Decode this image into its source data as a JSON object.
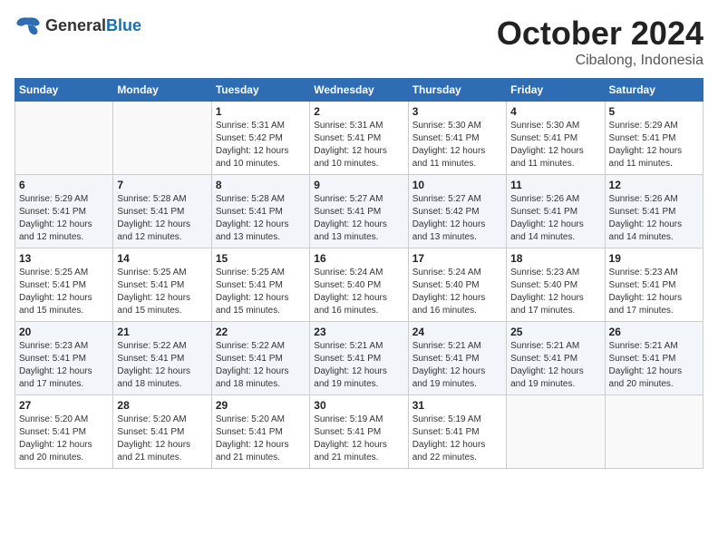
{
  "header": {
    "logo_general": "General",
    "logo_blue": "Blue",
    "month": "October 2024",
    "location": "Cibalong, Indonesia"
  },
  "days_of_week": [
    "Sunday",
    "Monday",
    "Tuesday",
    "Wednesday",
    "Thursday",
    "Friday",
    "Saturday"
  ],
  "weeks": [
    {
      "days": [
        {
          "num": "",
          "info": ""
        },
        {
          "num": "",
          "info": ""
        },
        {
          "num": "1",
          "info": "Sunrise: 5:31 AM\nSunset: 5:42 PM\nDaylight: 12 hours\nand 10 minutes."
        },
        {
          "num": "2",
          "info": "Sunrise: 5:31 AM\nSunset: 5:41 PM\nDaylight: 12 hours\nand 10 minutes."
        },
        {
          "num": "3",
          "info": "Sunrise: 5:30 AM\nSunset: 5:41 PM\nDaylight: 12 hours\nand 11 minutes."
        },
        {
          "num": "4",
          "info": "Sunrise: 5:30 AM\nSunset: 5:41 PM\nDaylight: 12 hours\nand 11 minutes."
        },
        {
          "num": "5",
          "info": "Sunrise: 5:29 AM\nSunset: 5:41 PM\nDaylight: 12 hours\nand 11 minutes."
        }
      ]
    },
    {
      "days": [
        {
          "num": "6",
          "info": "Sunrise: 5:29 AM\nSunset: 5:41 PM\nDaylight: 12 hours\nand 12 minutes."
        },
        {
          "num": "7",
          "info": "Sunrise: 5:28 AM\nSunset: 5:41 PM\nDaylight: 12 hours\nand 12 minutes."
        },
        {
          "num": "8",
          "info": "Sunrise: 5:28 AM\nSunset: 5:41 PM\nDaylight: 12 hours\nand 13 minutes."
        },
        {
          "num": "9",
          "info": "Sunrise: 5:27 AM\nSunset: 5:41 PM\nDaylight: 12 hours\nand 13 minutes."
        },
        {
          "num": "10",
          "info": "Sunrise: 5:27 AM\nSunset: 5:42 PM\nDaylight: 12 hours\nand 13 minutes."
        },
        {
          "num": "11",
          "info": "Sunrise: 5:26 AM\nSunset: 5:41 PM\nDaylight: 12 hours\nand 14 minutes."
        },
        {
          "num": "12",
          "info": "Sunrise: 5:26 AM\nSunset: 5:41 PM\nDaylight: 12 hours\nand 14 minutes."
        }
      ]
    },
    {
      "days": [
        {
          "num": "13",
          "info": "Sunrise: 5:25 AM\nSunset: 5:41 PM\nDaylight: 12 hours\nand 15 minutes."
        },
        {
          "num": "14",
          "info": "Sunrise: 5:25 AM\nSunset: 5:41 PM\nDaylight: 12 hours\nand 15 minutes."
        },
        {
          "num": "15",
          "info": "Sunrise: 5:25 AM\nSunset: 5:41 PM\nDaylight: 12 hours\nand 15 minutes."
        },
        {
          "num": "16",
          "info": "Sunrise: 5:24 AM\nSunset: 5:40 PM\nDaylight: 12 hours\nand 16 minutes."
        },
        {
          "num": "17",
          "info": "Sunrise: 5:24 AM\nSunset: 5:40 PM\nDaylight: 12 hours\nand 16 minutes."
        },
        {
          "num": "18",
          "info": "Sunrise: 5:23 AM\nSunset: 5:40 PM\nDaylight: 12 hours\nand 17 minutes."
        },
        {
          "num": "19",
          "info": "Sunrise: 5:23 AM\nSunset: 5:41 PM\nDaylight: 12 hours\nand 17 minutes."
        }
      ]
    },
    {
      "days": [
        {
          "num": "20",
          "info": "Sunrise: 5:23 AM\nSunset: 5:41 PM\nDaylight: 12 hours\nand 17 minutes."
        },
        {
          "num": "21",
          "info": "Sunrise: 5:22 AM\nSunset: 5:41 PM\nDaylight: 12 hours\nand 18 minutes."
        },
        {
          "num": "22",
          "info": "Sunrise: 5:22 AM\nSunset: 5:41 PM\nDaylight: 12 hours\nand 18 minutes."
        },
        {
          "num": "23",
          "info": "Sunrise: 5:21 AM\nSunset: 5:41 PM\nDaylight: 12 hours\nand 19 minutes."
        },
        {
          "num": "24",
          "info": "Sunrise: 5:21 AM\nSunset: 5:41 PM\nDaylight: 12 hours\nand 19 minutes."
        },
        {
          "num": "25",
          "info": "Sunrise: 5:21 AM\nSunset: 5:41 PM\nDaylight: 12 hours\nand 19 minutes."
        },
        {
          "num": "26",
          "info": "Sunrise: 5:21 AM\nSunset: 5:41 PM\nDaylight: 12 hours\nand 20 minutes."
        }
      ]
    },
    {
      "days": [
        {
          "num": "27",
          "info": "Sunrise: 5:20 AM\nSunset: 5:41 PM\nDaylight: 12 hours\nand 20 minutes."
        },
        {
          "num": "28",
          "info": "Sunrise: 5:20 AM\nSunset: 5:41 PM\nDaylight: 12 hours\nand 21 minutes."
        },
        {
          "num": "29",
          "info": "Sunrise: 5:20 AM\nSunset: 5:41 PM\nDaylight: 12 hours\nand 21 minutes."
        },
        {
          "num": "30",
          "info": "Sunrise: 5:19 AM\nSunset: 5:41 PM\nDaylight: 12 hours\nand 21 minutes."
        },
        {
          "num": "31",
          "info": "Sunrise: 5:19 AM\nSunset: 5:41 PM\nDaylight: 12 hours\nand 22 minutes."
        },
        {
          "num": "",
          "info": ""
        },
        {
          "num": "",
          "info": ""
        }
      ]
    }
  ]
}
